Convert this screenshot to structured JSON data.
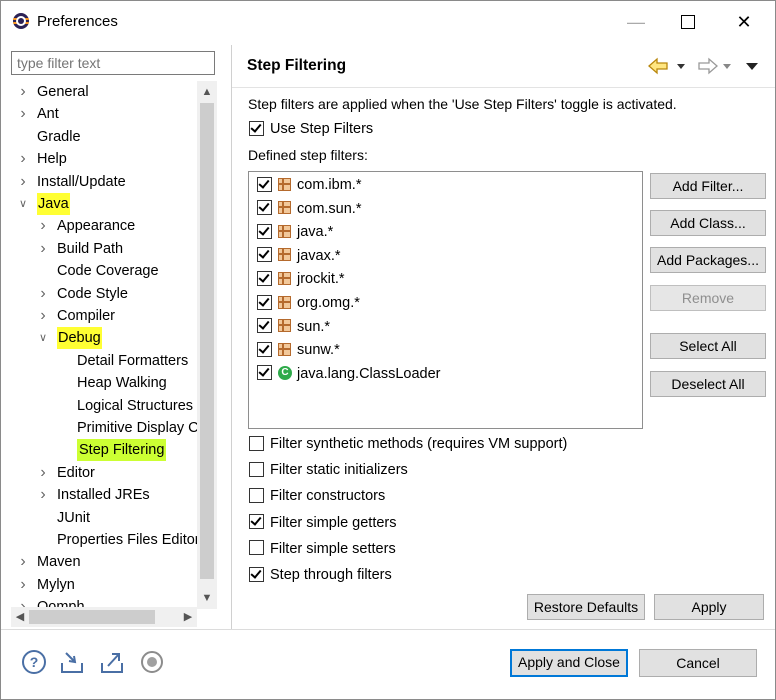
{
  "window": {
    "title": "Preferences",
    "min_glyph": "—",
    "close_glyph": "✕"
  },
  "left": {
    "filter_placeholder": "type filter text",
    "tree": [
      {
        "label": "General",
        "indent": 0,
        "expander": "collapsed"
      },
      {
        "label": "Ant",
        "indent": 0,
        "expander": "collapsed"
      },
      {
        "label": "Gradle",
        "indent": 0,
        "expander": "none"
      },
      {
        "label": "Help",
        "indent": 0,
        "expander": "collapsed"
      },
      {
        "label": "Install/Update",
        "indent": 0,
        "expander": "collapsed"
      },
      {
        "label": "Java",
        "indent": 0,
        "expander": "expanded",
        "highlight": true
      },
      {
        "label": "Appearance",
        "indent": 1,
        "expander": "collapsed"
      },
      {
        "label": "Build Path",
        "indent": 1,
        "expander": "collapsed"
      },
      {
        "label": "Code Coverage",
        "indent": 1,
        "expander": "none"
      },
      {
        "label": "Code Style",
        "indent": 1,
        "expander": "collapsed"
      },
      {
        "label": "Compiler",
        "indent": 1,
        "expander": "collapsed"
      },
      {
        "label": "Debug",
        "indent": 1,
        "expander": "expanded",
        "highlight": true
      },
      {
        "label": "Detail Formatters",
        "indent": 2,
        "expander": "none"
      },
      {
        "label": "Heap Walking",
        "indent": 2,
        "expander": "none"
      },
      {
        "label": "Logical Structures",
        "indent": 2,
        "expander": "none"
      },
      {
        "label": "Primitive Display C",
        "indent": 2,
        "expander": "none"
      },
      {
        "label": "Step Filtering",
        "indent": 2,
        "expander": "none",
        "selected": true
      },
      {
        "label": "Editor",
        "indent": 1,
        "expander": "collapsed"
      },
      {
        "label": "Installed JREs",
        "indent": 1,
        "expander": "collapsed"
      },
      {
        "label": "JUnit",
        "indent": 1,
        "expander": "none"
      },
      {
        "label": "Properties Files Editor",
        "indent": 1,
        "expander": "none"
      },
      {
        "label": "Maven",
        "indent": 0,
        "expander": "collapsed"
      },
      {
        "label": "Mylyn",
        "indent": 0,
        "expander": "collapsed"
      },
      {
        "label": "Oomph",
        "indent": 0,
        "expander": "collapsed"
      }
    ]
  },
  "page": {
    "title": "Step Filtering",
    "description": "Step filters are applied when the 'Use Step Filters' toggle is activated.",
    "use_step_filters": {
      "label": "Use Step Filters",
      "checked": true
    },
    "defined_label": "Defined step filters:",
    "filters": [
      {
        "label": "com.ibm.*",
        "checked": true,
        "kind": "package"
      },
      {
        "label": "com.sun.*",
        "checked": true,
        "kind": "package"
      },
      {
        "label": "java.*",
        "checked": true,
        "kind": "package"
      },
      {
        "label": "javax.*",
        "checked": true,
        "kind": "package"
      },
      {
        "label": "jrockit.*",
        "checked": true,
        "kind": "package"
      },
      {
        "label": "org.omg.*",
        "checked": true,
        "kind": "package"
      },
      {
        "label": "sun.*",
        "checked": true,
        "kind": "package"
      },
      {
        "label": "sunw.*",
        "checked": true,
        "kind": "package"
      },
      {
        "label": "java.lang.ClassLoader",
        "checked": true,
        "kind": "class"
      }
    ],
    "buttons": {
      "add_filter": "Add Filter...",
      "add_class": "Add Class...",
      "add_packages": "Add Packages...",
      "remove": "Remove",
      "select_all": "Select All",
      "deselect_all": "Deselect All"
    },
    "options": [
      {
        "label": "Filter synthetic methods (requires VM support)",
        "checked": false
      },
      {
        "label": "Filter static initializers",
        "checked": false
      },
      {
        "label": "Filter constructors",
        "checked": false
      },
      {
        "label": "Filter simple getters",
        "checked": true
      },
      {
        "label": "Filter simple setters",
        "checked": false
      },
      {
        "label": "Step through filters",
        "checked": true
      }
    ],
    "restore_defaults": "Restore Defaults",
    "apply": "Apply"
  },
  "footer": {
    "apply_and_close": "Apply and Close",
    "cancel": "Cancel",
    "icons": [
      "help-icon",
      "import-icon",
      "export-icon",
      "record-icon"
    ]
  },
  "colors": {
    "highlight": "#ffff33",
    "selected_highlight": "#ccff33",
    "focus_border": "#0078d7"
  }
}
